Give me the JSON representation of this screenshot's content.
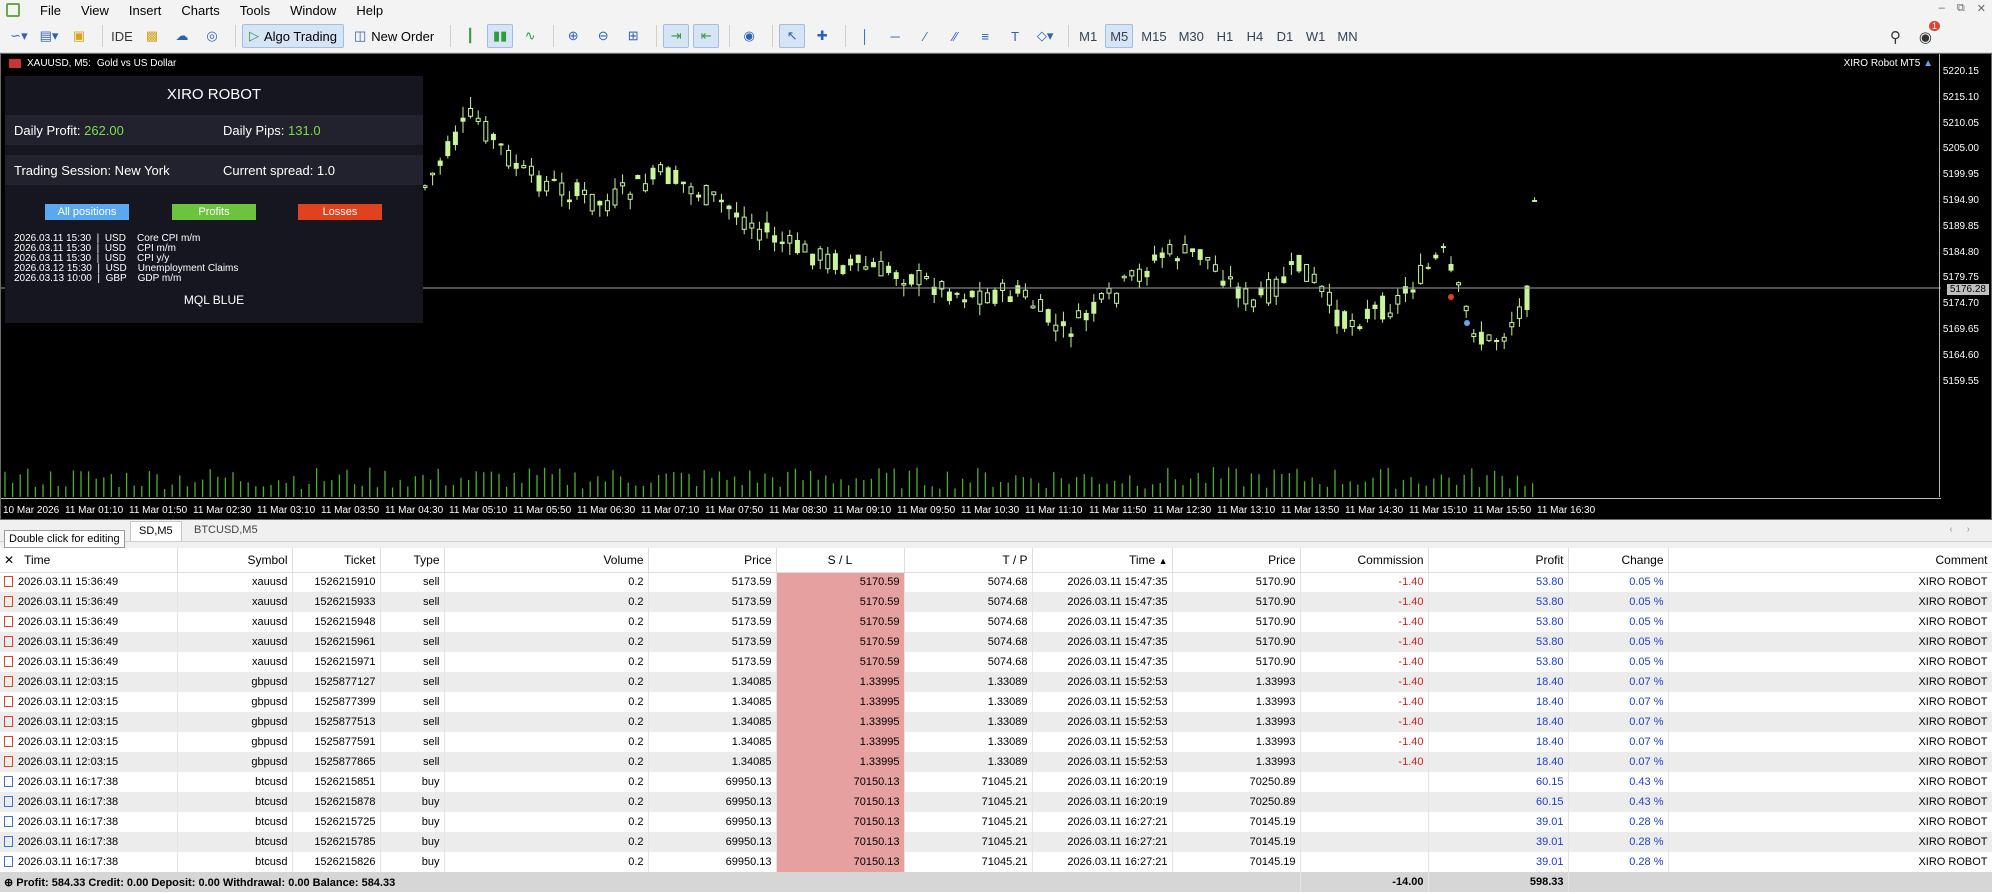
{
  "menu": [
    "File",
    "View",
    "Insert",
    "Charts",
    "Tools",
    "Window",
    "Help"
  ],
  "toolbar": {
    "ide": "IDE",
    "algo_trading": "Algo Trading",
    "new_order": "New Order",
    "timeframes": [
      "M1",
      "M5",
      "M15",
      "M30",
      "H1",
      "H4",
      "D1",
      "W1",
      "MN"
    ],
    "selected_timeframe": "M5",
    "notifications": "1"
  },
  "chart": {
    "symbol": "XAUUSD, M5:",
    "description": "Gold vs US Dollar",
    "ea_name": "XIRO Robot MT5",
    "price_labels": [
      "5220.15",
      "5215.10",
      "5210.05",
      "5205.00",
      "5199.95",
      "5194.90",
      "5189.85",
      "5184.80",
      "5179.75",
      "5174.70",
      "5169.65",
      "5164.60",
      "5159.55"
    ],
    "current_price": "5176.28",
    "time_labels": [
      "10 Mar 2026",
      "11 Mar 01:10",
      "11 Mar 01:50",
      "11 Mar 02:30",
      "11 Mar 03:10",
      "11 Mar 03:50",
      "11 Mar 04:30",
      "11 Mar 05:10",
      "11 Mar 05:50",
      "11 Mar 06:30",
      "11 Mar 07:10",
      "11 Mar 07:50",
      "11 Mar 08:30",
      "11 Mar 09:10",
      "11 Mar 09:50",
      "11 Mar 10:30",
      "11 Mar 11:10",
      "11 Mar 11:50",
      "11 Mar 12:30",
      "11 Mar 13:10",
      "11 Mar 13:50",
      "11 Mar 14:30",
      "11 Mar 15:10",
      "11 Mar 15:50",
      "11 Mar 16:30"
    ],
    "candle_color": "#c8f59a",
    "volume_color": "#4caf2a"
  },
  "panel": {
    "title": "XIRO ROBOT",
    "daily_profit_label": "Daily Profit:",
    "daily_profit": "262.00",
    "daily_pips_label": "Daily Pips:",
    "daily_pips": "131.0",
    "session": "Trading Session: New York",
    "spread": "Current spread: 1.0",
    "buttons": {
      "all": "All positions",
      "profits": "Profits",
      "losses": "Losses"
    },
    "button_colors": {
      "all": "#5aa9f0",
      "profits": "#6cc33d",
      "losses": "#e0421f"
    },
    "news": [
      "2026.03.11 15:30  |  USD    Core CPI m/m",
      "2026.03.11 15:30  |  USD    CPI m/m",
      "2026.03.11 15:30  |  USD    CPI y/y",
      "2026.03.12 15:30  |  USD    Unemployment Claims",
      "2026.03.13 10:00  |  GBP    GDP m/m"
    ],
    "brand": "MQL BLUE"
  },
  "tabs": {
    "tab1": "SD,M5",
    "tab2": "BTCUSD,M5",
    "tooltip": "Double click for editing"
  },
  "table": {
    "headers": [
      "Time",
      "Symbol",
      "Ticket",
      "Type",
      "Volume",
      "Price",
      "S / L",
      "T / P",
      "Time",
      "Price",
      "Commission",
      "Profit",
      "Change",
      "Comment"
    ],
    "rows": [
      [
        "2026.03.11 15:36:49",
        "xauusd",
        "1526215910",
        "sell",
        "0.2",
        "5173.59",
        "5170.59",
        "5074.68",
        "2026.03.11 15:47:35",
        "5170.90",
        "-1.40",
        "53.80",
        "0.05 %",
        "XIRO ROBOT"
      ],
      [
        "2026.03.11 15:36:49",
        "xauusd",
        "1526215933",
        "sell",
        "0.2",
        "5173.59",
        "5170.59",
        "5074.68",
        "2026.03.11 15:47:35",
        "5170.90",
        "-1.40",
        "53.80",
        "0.05 %",
        "XIRO ROBOT"
      ],
      [
        "2026.03.11 15:36:49",
        "xauusd",
        "1526215948",
        "sell",
        "0.2",
        "5173.59",
        "5170.59",
        "5074.68",
        "2026.03.11 15:47:35",
        "5170.90",
        "-1.40",
        "53.80",
        "0.05 %",
        "XIRO ROBOT"
      ],
      [
        "2026.03.11 15:36:49",
        "xauusd",
        "1526215961",
        "sell",
        "0.2",
        "5173.59",
        "5170.59",
        "5074.68",
        "2026.03.11 15:47:35",
        "5170.90",
        "-1.40",
        "53.80",
        "0.05 %",
        "XIRO ROBOT"
      ],
      [
        "2026.03.11 15:36:49",
        "xauusd",
        "1526215971",
        "sell",
        "0.2",
        "5173.59",
        "5170.59",
        "5074.68",
        "2026.03.11 15:47:35",
        "5170.90",
        "-1.40",
        "53.80",
        "0.05 %",
        "XIRO ROBOT"
      ],
      [
        "2026.03.11 12:03:15",
        "gbpusd",
        "1525877127",
        "sell",
        "0.2",
        "1.34085",
        "1.33995",
        "1.33089",
        "2026.03.11 15:52:53",
        "1.33993",
        "-1.40",
        "18.40",
        "0.07 %",
        "XIRO ROBOT"
      ],
      [
        "2026.03.11 12:03:15",
        "gbpusd",
        "1525877399",
        "sell",
        "0.2",
        "1.34085",
        "1.33995",
        "1.33089",
        "2026.03.11 15:52:53",
        "1.33993",
        "-1.40",
        "18.40",
        "0.07 %",
        "XIRO ROBOT"
      ],
      [
        "2026.03.11 12:03:15",
        "gbpusd",
        "1525877513",
        "sell",
        "0.2",
        "1.34085",
        "1.33995",
        "1.33089",
        "2026.03.11 15:52:53",
        "1.33993",
        "-1.40",
        "18.40",
        "0.07 %",
        "XIRO ROBOT"
      ],
      [
        "2026.03.11 12:03:15",
        "gbpusd",
        "1525877591",
        "sell",
        "0.2",
        "1.34085",
        "1.33995",
        "1.33089",
        "2026.03.11 15:52:53",
        "1.33993",
        "-1.40",
        "18.40",
        "0.07 %",
        "XIRO ROBOT"
      ],
      [
        "2026.03.11 12:03:15",
        "gbpusd",
        "1525877865",
        "sell",
        "0.2",
        "1.34085",
        "1.33995",
        "1.33089",
        "2026.03.11 15:52:53",
        "1.33993",
        "-1.40",
        "18.40",
        "0.07 %",
        "XIRO ROBOT"
      ],
      [
        "2026.03.11 16:17:38",
        "btcusd",
        "1526215851",
        "buy",
        "0.2",
        "69950.13",
        "70150.13",
        "71045.21",
        "2026.03.11 16:20:19",
        "70250.89",
        "",
        "60.15",
        "0.43 %",
        "XIRO ROBOT"
      ],
      [
        "2026.03.11 16:17:38",
        "btcusd",
        "1526215878",
        "buy",
        "0.2",
        "69950.13",
        "70150.13",
        "71045.21",
        "2026.03.11 16:20:19",
        "70250.89",
        "",
        "60.15",
        "0.43 %",
        "XIRO ROBOT"
      ],
      [
        "2026.03.11 16:17:38",
        "btcusd",
        "1526215725",
        "buy",
        "0.2",
        "69950.13",
        "70150.13",
        "71045.21",
        "2026.03.11 16:27:21",
        "70145.19",
        "",
        "39.01",
        "0.28 %",
        "XIRO ROBOT"
      ],
      [
        "2026.03.11 16:17:38",
        "btcusd",
        "1526215785",
        "buy",
        "0.2",
        "69950.13",
        "70150.13",
        "71045.21",
        "2026.03.11 16:27:21",
        "70145.19",
        "",
        "39.01",
        "0.28 %",
        "XIRO ROBOT"
      ],
      [
        "2026.03.11 16:17:38",
        "btcusd",
        "1526215826",
        "buy",
        "0.2",
        "69950.13",
        "70150.13",
        "71045.21",
        "2026.03.11 16:27:21",
        "70145.19",
        "",
        "39.01",
        "0.28 %",
        "XIRO ROBOT"
      ]
    ],
    "summary": "Profit: 584.33   Credit: 0.00   Deposit: 0.00   Withdrawal: 0.00   Balance: 584.33",
    "total_commission": "-14.00",
    "total_profit": "598.33"
  }
}
